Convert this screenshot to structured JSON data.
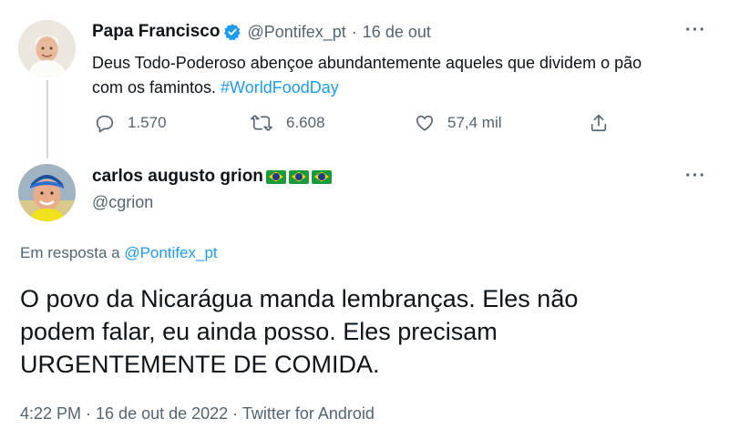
{
  "tweet1": {
    "display_name": "Papa Francisco",
    "handle": "@Pontifex_pt",
    "separator": "·",
    "date": "16 de out",
    "text_line1": "Deus Todo-Poderoso abençoe abundantemente aqueles que dividem o pão",
    "text_line2_prefix": "com os famintos. ",
    "hashtag": "#WorldFoodDay",
    "replies": "1.570",
    "retweets": "6.608",
    "likes": "57,4 mil",
    "more": "···",
    "icons": [
      "verified-badge-icon",
      "reply-icon",
      "retweet-icon",
      "like-icon",
      "share-icon"
    ]
  },
  "tweet2": {
    "display_name": "carlos augusto grion",
    "handle": "@cgrion",
    "more": "···",
    "flag_count": 3,
    "reply_prefix": "Em resposta a ",
    "reply_to": "@Pontifex_pt",
    "body_line1": "O povo da Nicarágua manda lembranças. Eles não",
    "body_line2": "podem falar, eu ainda posso. Eles precisam",
    "body_line3": "URGENTEMENTE DE COMIDA.",
    "meta": "4:22 PM · 16 de out de 2022 · Twitter for Android"
  },
  "colors": {
    "accent": "#1d9bf0",
    "muted": "#536471",
    "text": "#0f1419",
    "thread_line": "#cfd9de"
  }
}
